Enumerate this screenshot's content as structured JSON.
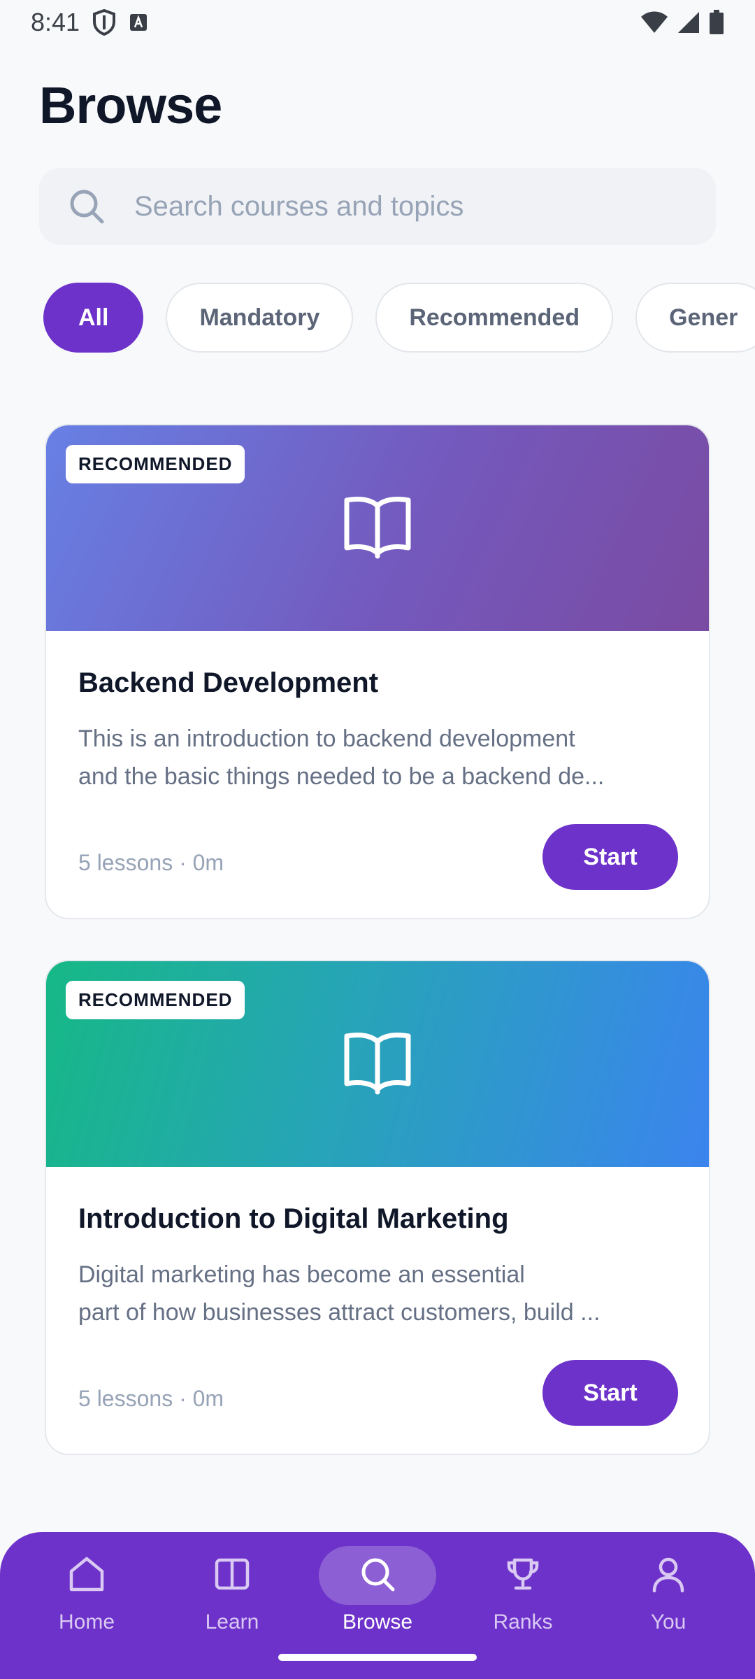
{
  "status_bar": {
    "time": "8:41"
  },
  "page": {
    "title": "Browse"
  },
  "search": {
    "placeholder": "Search courses and topics"
  },
  "filters": [
    {
      "label": "All",
      "active": true
    },
    {
      "label": "Mandatory",
      "active": false
    },
    {
      "label": "Recommended",
      "active": false
    },
    {
      "label": "Gener",
      "active": false
    }
  ],
  "courses": [
    {
      "badge": "RECOMMENDED",
      "title": "Backend Development",
      "description_line1": "This is an introduction to backend development",
      "description_line2": "and the basic things needed to be a backend de...",
      "meta": "5 lessons · 0m",
      "button": "Start"
    },
    {
      "badge": "RECOMMENDED",
      "title": "Introduction to Digital Marketing",
      "description_line1": "Digital marketing has become an essential",
      "description_line2": "part of how businesses attract customers, build ...",
      "meta": "5 lessons · 0m",
      "button": "Start"
    }
  ],
  "nav": [
    {
      "label": "Home",
      "icon": "home-icon"
    },
    {
      "label": "Learn",
      "icon": "book-columns-icon"
    },
    {
      "label": "Browse",
      "icon": "search-icon",
      "active": true
    },
    {
      "label": "Ranks",
      "icon": "trophy-icon"
    },
    {
      "label": "You",
      "icon": "person-icon"
    }
  ],
  "colors": {
    "accent": "#6d32c9",
    "background": "#f8f9fa",
    "text_primary": "#0f1729",
    "text_secondary": "#667085"
  }
}
